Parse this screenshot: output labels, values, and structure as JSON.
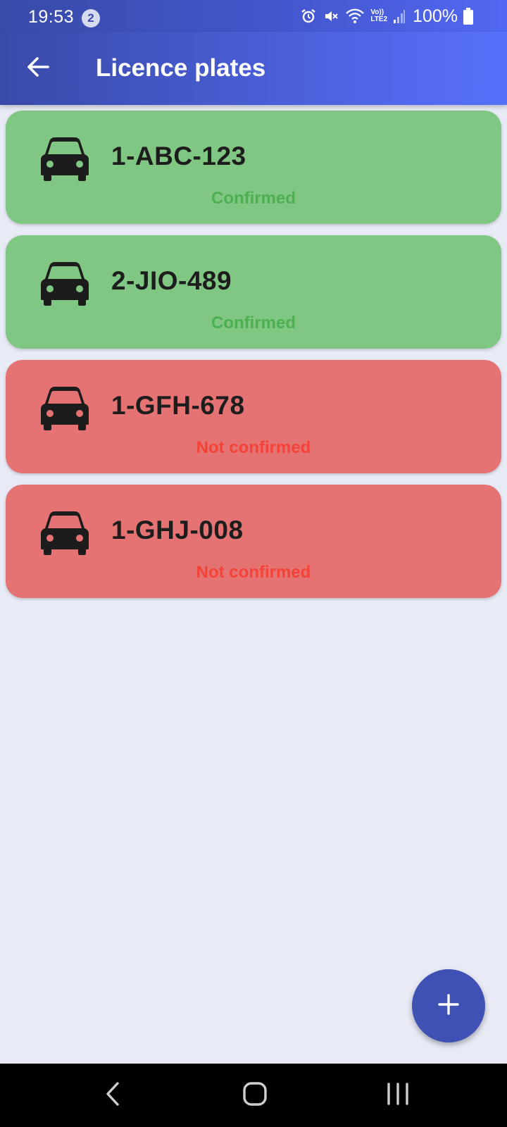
{
  "status_bar": {
    "time": "19:53",
    "notification_count": "2",
    "battery": "100%",
    "network_label_top": "Vo))",
    "network_label_bottom": "LTE2"
  },
  "app_bar": {
    "title": "Licence plates"
  },
  "plates": [
    {
      "number": "1-ABC-123",
      "status": "Confirmed",
      "confirmed": true
    },
    {
      "number": "2-JIO-489",
      "status": "Confirmed",
      "confirmed": true
    },
    {
      "number": "1-GFH-678",
      "status": "Not confirmed",
      "confirmed": false
    },
    {
      "number": "1-GHJ-008",
      "status": "Not confirmed",
      "confirmed": false
    }
  ],
  "icons": {
    "back": "arrow-back-icon",
    "car": "car-icon",
    "add": "plus-icon",
    "nav_back": "nav-back-icon",
    "nav_home": "nav-home-icon",
    "nav_recents": "nav-recents-icon"
  },
  "colors": {
    "app_bar_start": "#3a4aa8",
    "app_bar_end": "#5670fb",
    "confirmed_bg": "#81c784",
    "confirmed_text": "#4caf50",
    "unconfirmed_bg": "#e57373",
    "unconfirmed_text": "#f44336",
    "fab": "#3f51b5",
    "background": "#e8eaf6"
  }
}
